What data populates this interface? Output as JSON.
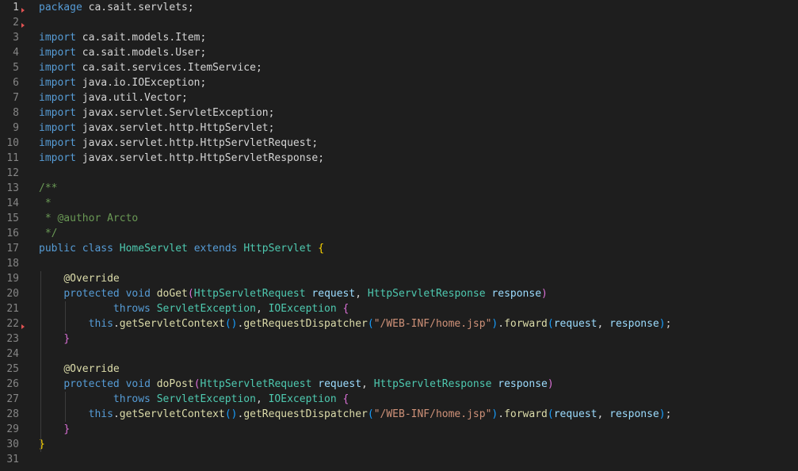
{
  "editor": {
    "lines": [
      [
        [
          "package",
          "kw"
        ],
        [
          " ca.sait.servlets;",
          "pl"
        ]
      ],
      [],
      [
        [
          "import",
          "kw"
        ],
        [
          " ca.sait.models.Item;",
          "pl"
        ]
      ],
      [
        [
          "import",
          "kw"
        ],
        [
          " ca.sait.models.User;",
          "pl"
        ]
      ],
      [
        [
          "import",
          "kw"
        ],
        [
          " ca.sait.services.ItemService;",
          "pl"
        ]
      ],
      [
        [
          "import",
          "kw"
        ],
        [
          " java.io.IOException;",
          "pl"
        ]
      ],
      [
        [
          "import",
          "kw"
        ],
        [
          " java.util.Vector;",
          "pl"
        ]
      ],
      [
        [
          "import",
          "kw"
        ],
        [
          " javax.servlet.ServletException;",
          "pl"
        ]
      ],
      [
        [
          "import",
          "kw"
        ],
        [
          " javax.servlet.http.HttpServlet;",
          "pl"
        ]
      ],
      [
        [
          "import",
          "kw"
        ],
        [
          " javax.servlet.http.HttpServletRequest;",
          "pl"
        ]
      ],
      [
        [
          "import",
          "kw"
        ],
        [
          " javax.servlet.http.HttpServletResponse;",
          "pl"
        ]
      ],
      [],
      [
        [
          "/**",
          "cm"
        ]
      ],
      [
        [
          " *",
          "cm"
        ]
      ],
      [
        [
          " * @author",
          "cm"
        ],
        [
          " Arcto",
          "cm"
        ]
      ],
      [
        [
          " */",
          "cm"
        ]
      ],
      [
        [
          "public",
          "kw"
        ],
        [
          " ",
          "pl"
        ],
        [
          "class",
          "kw"
        ],
        [
          " ",
          "pl"
        ],
        [
          "HomeServlet",
          "typ"
        ],
        [
          " ",
          "pl"
        ],
        [
          "extends",
          "kw"
        ],
        [
          " ",
          "pl"
        ],
        [
          "HttpServlet",
          "typ"
        ],
        [
          " ",
          "pl"
        ],
        [
          "{",
          "br1"
        ]
      ],
      [],
      [
        [
          "    ",
          "pl"
        ],
        [
          "@Override",
          "an"
        ]
      ],
      [
        [
          "    ",
          "pl"
        ],
        [
          "protected",
          "kw"
        ],
        [
          " ",
          "pl"
        ],
        [
          "void",
          "kw"
        ],
        [
          " ",
          "pl"
        ],
        [
          "doGet",
          "fn"
        ],
        [
          "(",
          "br2"
        ],
        [
          "HttpServletRequest",
          "typ"
        ],
        [
          " ",
          "pl"
        ],
        [
          "request",
          "var"
        ],
        [
          ", ",
          "pl"
        ],
        [
          "HttpServletResponse",
          "typ"
        ],
        [
          " ",
          "pl"
        ],
        [
          "response",
          "var"
        ],
        [
          ")",
          "br2"
        ]
      ],
      [
        [
          "            ",
          "pl"
        ],
        [
          "throws",
          "kw"
        ],
        [
          " ",
          "pl"
        ],
        [
          "ServletException",
          "typ"
        ],
        [
          ", ",
          "pl"
        ],
        [
          "IOException",
          "typ"
        ],
        [
          " ",
          "pl"
        ],
        [
          "{",
          "br2"
        ]
      ],
      [
        [
          "        ",
          "pl"
        ],
        [
          "this",
          "kw"
        ],
        [
          ".",
          "pl"
        ],
        [
          "getServletContext",
          "fn"
        ],
        [
          "()",
          "br3"
        ],
        [
          ".",
          "pl"
        ],
        [
          "getRequestDispatcher",
          "fn"
        ],
        [
          "(",
          "br3"
        ],
        [
          "\"/WEB-INF/home.jsp\"",
          "str"
        ],
        [
          ")",
          "br3"
        ],
        [
          ".",
          "pl"
        ],
        [
          "forward",
          "fn"
        ],
        [
          "(",
          "br3"
        ],
        [
          "request",
          "var"
        ],
        [
          ", ",
          "pl"
        ],
        [
          "response",
          "var"
        ],
        [
          ")",
          "br3"
        ],
        [
          ";",
          "pl"
        ]
      ],
      [
        [
          "    ",
          "pl"
        ],
        [
          "}",
          "br2"
        ]
      ],
      [],
      [
        [
          "    ",
          "pl"
        ],
        [
          "@Override",
          "an"
        ]
      ],
      [
        [
          "    ",
          "pl"
        ],
        [
          "protected",
          "kw"
        ],
        [
          " ",
          "pl"
        ],
        [
          "void",
          "kw"
        ],
        [
          " ",
          "pl"
        ],
        [
          "doPost",
          "fn"
        ],
        [
          "(",
          "br2"
        ],
        [
          "HttpServletRequest",
          "typ"
        ],
        [
          " ",
          "pl"
        ],
        [
          "request",
          "var"
        ],
        [
          ", ",
          "pl"
        ],
        [
          "HttpServletResponse",
          "typ"
        ],
        [
          " ",
          "pl"
        ],
        [
          "response",
          "var"
        ],
        [
          ")",
          "br2"
        ]
      ],
      [
        [
          "            ",
          "pl"
        ],
        [
          "throws",
          "kw"
        ],
        [
          " ",
          "pl"
        ],
        [
          "ServletException",
          "typ"
        ],
        [
          ", ",
          "pl"
        ],
        [
          "IOException",
          "typ"
        ],
        [
          " ",
          "pl"
        ],
        [
          "{",
          "br2"
        ]
      ],
      [
        [
          "        ",
          "pl"
        ],
        [
          "this",
          "kw"
        ],
        [
          ".",
          "pl"
        ],
        [
          "getServletContext",
          "fn"
        ],
        [
          "()",
          "br3"
        ],
        [
          ".",
          "pl"
        ],
        [
          "getRequestDispatcher",
          "fn"
        ],
        [
          "(",
          "br3"
        ],
        [
          "\"/WEB-INF/home.jsp\"",
          "str"
        ],
        [
          ")",
          "br3"
        ],
        [
          ".",
          "pl"
        ],
        [
          "forward",
          "fn"
        ],
        [
          "(",
          "br3"
        ],
        [
          "request",
          "var"
        ],
        [
          ", ",
          "pl"
        ],
        [
          "response",
          "var"
        ],
        [
          ")",
          "br3"
        ],
        [
          ";",
          "pl"
        ]
      ],
      [
        [
          "    ",
          "pl"
        ],
        [
          "}",
          "br2"
        ]
      ],
      [
        [
          "}",
          "br1"
        ]
      ],
      []
    ],
    "active_line": 1,
    "marker_lines": [
      1,
      2,
      22
    ]
  }
}
